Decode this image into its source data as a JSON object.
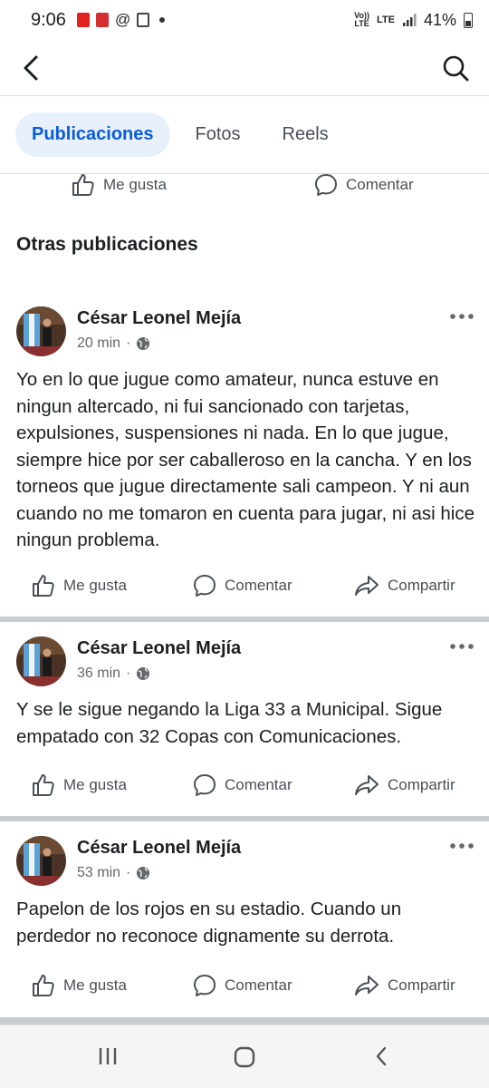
{
  "status_bar": {
    "time": "9:06",
    "volte": "Vo))",
    "lte_small": "LTE",
    "lte": "LTE",
    "battery": "41%"
  },
  "app_bar": {
    "back_icon": "back-arrow-icon",
    "search_icon": "search-icon"
  },
  "tabs": [
    {
      "label": "Publicaciones",
      "active": true
    },
    {
      "label": "Fotos",
      "active": false
    },
    {
      "label": "Reels",
      "active": false
    }
  ],
  "partial_actions": {
    "like": "Me gusta",
    "comment": "Comentar"
  },
  "section_title": "Otras publicaciones",
  "posts": [
    {
      "author": "César Leonel Mejía",
      "time": "20 min",
      "visibility": "·",
      "text": "Yo en lo que jugue como amateur, nunca estuve en ningun altercado, ni fui sancionado con tarjetas, expulsiones, suspensiones ni nada. En lo que jugue, siempre hice por ser caballeroso en la cancha. Y en los torneos que jugue directamente sali campeon. Y ni aun cuando no me tomaron en cuenta para jugar, ni asi hice ningun problema.",
      "like": "Me gusta",
      "comment": "Comentar",
      "share": "Compartir"
    },
    {
      "author": "César Leonel Mejía",
      "time": "36 min",
      "visibility": "·",
      "text": "Y se le sigue negando la Liga 33 a Municipal. Sigue empatado con 32 Copas con Comunicaciones.",
      "like": "Me gusta",
      "comment": "Comentar",
      "share": "Compartir"
    },
    {
      "author": "César Leonel Mejía",
      "time": "53 min",
      "visibility": "·",
      "text": "Papelon de los rojos en su estadio. Cuando un perdedor no reconoce dignamente su derrota.",
      "like": "Me gusta",
      "comment": "Comentar",
      "share": "Compartir"
    }
  ],
  "colors": {
    "accent": "#0a5bd6",
    "tab_active_bg": "#e7f0fb",
    "divider": "#c9ccd1",
    "secondary_text": "#65676b"
  }
}
